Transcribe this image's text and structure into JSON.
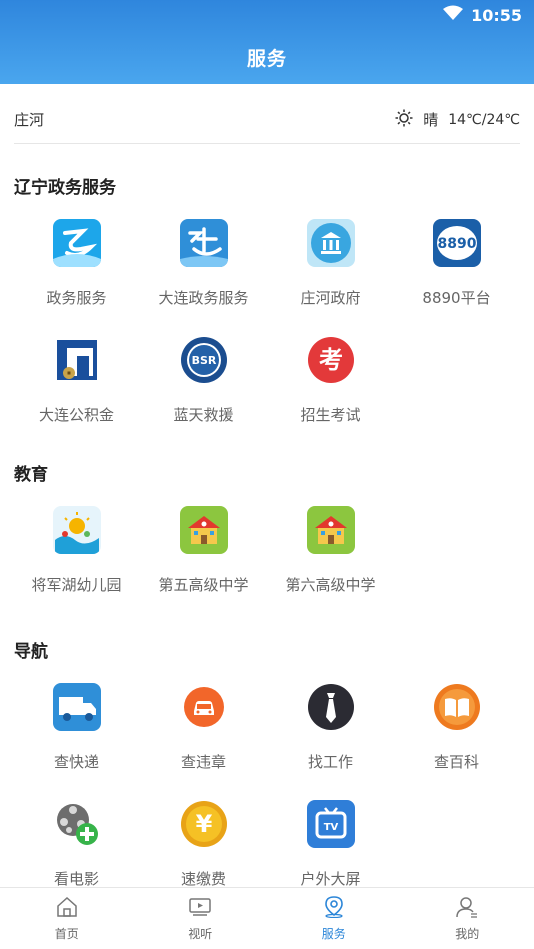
{
  "status": {
    "time": "10:55"
  },
  "header": {
    "title": "服务"
  },
  "location": {
    "name": "庄河",
    "weather": "晴",
    "temp": "14℃/24℃"
  },
  "sections": [
    {
      "title": "辽宁政务服务",
      "items": [
        {
          "label": "政务服务",
          "icon": "liaoning-gov-icon"
        },
        {
          "label": "大连政务服务",
          "icon": "dalian-gov-icon"
        },
        {
          "label": "庄河政府",
          "icon": "government-building-icon"
        },
        {
          "label": "8890平台",
          "icon": "8890-platform-icon"
        },
        {
          "label": "大连公积金",
          "icon": "housing-fund-icon"
        },
        {
          "label": "蓝天救援",
          "icon": "bsr-rescue-icon"
        },
        {
          "label": "招生考试",
          "icon": "exam-icon"
        }
      ]
    },
    {
      "title": "教育",
      "items": [
        {
          "label": "将军湖幼儿园",
          "icon": "kindergarten-icon"
        },
        {
          "label": "第五高级中学",
          "icon": "school-icon"
        },
        {
          "label": "第六高级中学",
          "icon": "school-icon"
        }
      ]
    },
    {
      "title": "导航",
      "items": [
        {
          "label": "查快递",
          "icon": "delivery-truck-icon"
        },
        {
          "label": "查违章",
          "icon": "car-icon"
        },
        {
          "label": "找工作",
          "icon": "tie-icon"
        },
        {
          "label": "查百科",
          "icon": "book-icon"
        },
        {
          "label": "看电影",
          "icon": "film-reel-icon"
        },
        {
          "label": "速缴费",
          "icon": "yen-coin-icon"
        },
        {
          "label": "户外大屏",
          "icon": "tv-icon"
        }
      ]
    }
  ],
  "icon_badges": {
    "bsr": "BSR",
    "platform": "8890",
    "exam": "考",
    "yen": "¥",
    "tv": "TV"
  },
  "tabs": [
    {
      "label": "首页",
      "icon": "home-icon"
    },
    {
      "label": "视听",
      "icon": "video-icon"
    },
    {
      "label": "服务",
      "icon": "location-pin-icon",
      "active": true
    },
    {
      "label": "我的",
      "icon": "user-icon"
    }
  ],
  "colors": {
    "accent": "#2c86d8",
    "header_top": "#2f86dd",
    "header_bottom": "#4aa6ee"
  }
}
